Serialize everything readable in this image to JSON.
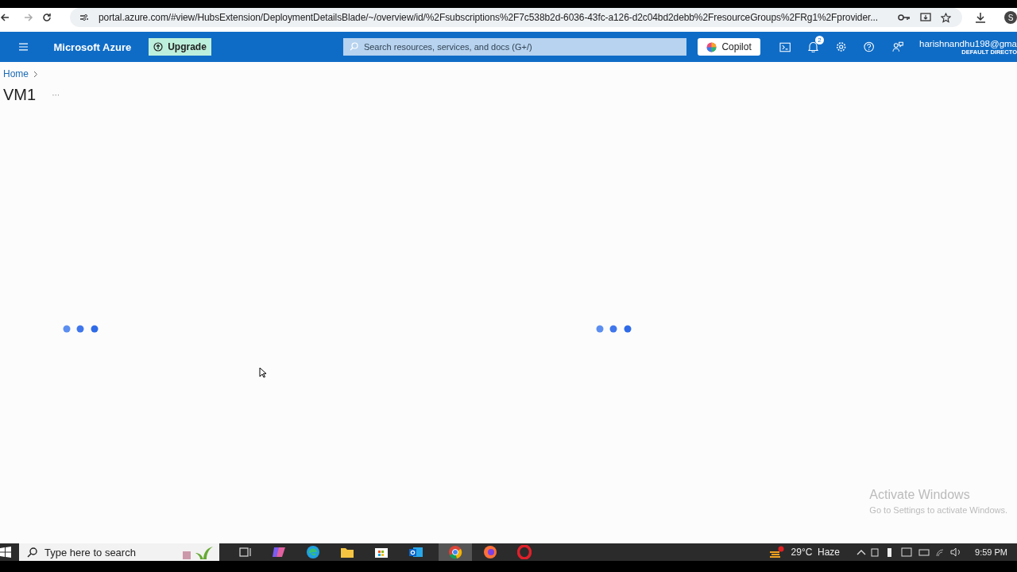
{
  "browser": {
    "url": "portal.azure.com/#view/HubsExtension/DeploymentDetailsBlade/~/overview/id/%2Fsubscriptions%2F7c538b2d-6036-43fc-a126-d2c04bd2debb%2FresourceGroups%2FRg1%2Fprovider...",
    "profile_initial": "S"
  },
  "header": {
    "brand": "Microsoft Azure",
    "upgrade": "Upgrade",
    "search": {
      "placeholder": "Search resources, services, and docs (G+/)"
    },
    "copilot": "Copilot",
    "notification_count": "2",
    "account": {
      "email": "harishnandhu198@gma",
      "directory": "DEFAULT DIRECTO"
    }
  },
  "breadcrumb": [
    "Home"
  ],
  "page": {
    "title": "VM1",
    "more": "···"
  },
  "loaders": [
    {
      "kind": "dots"
    },
    {
      "kind": "dots"
    }
  ],
  "activation": {
    "title": "Activate Windows",
    "subtitle": "Go to Settings to activate Windows."
  },
  "taskbar": {
    "search": {
      "placeholder": "Type here to search"
    },
    "weather": "29°C  Haze",
    "time": "9:59 PM"
  }
}
